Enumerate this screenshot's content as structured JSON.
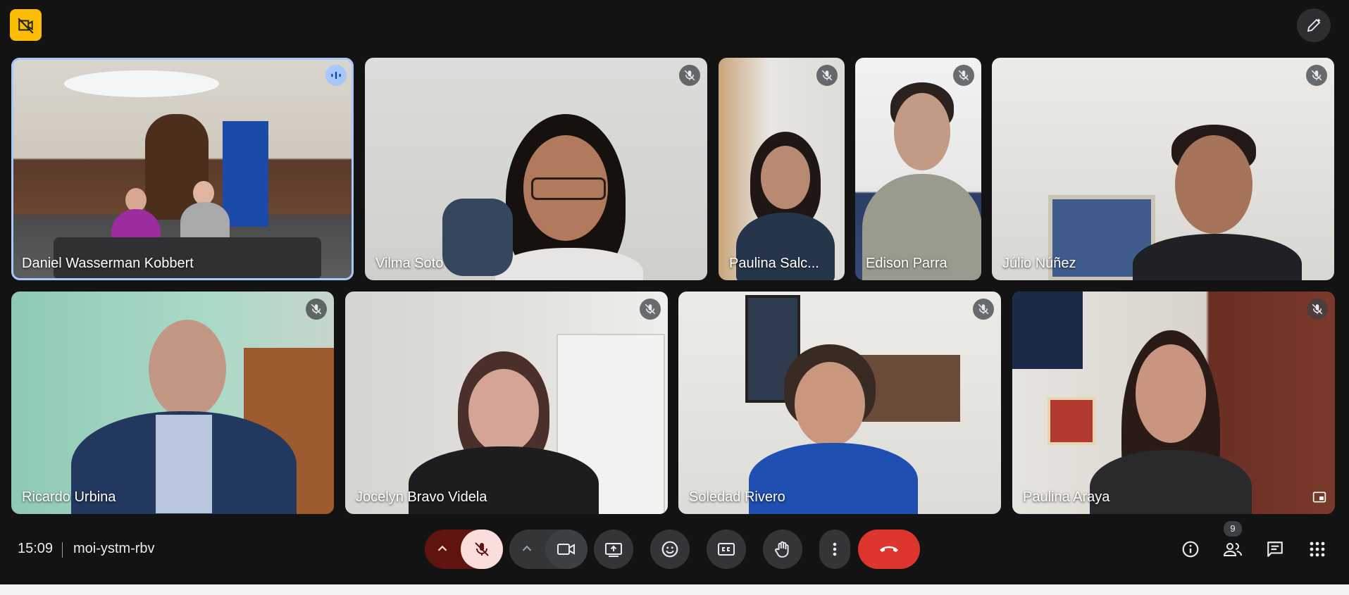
{
  "meeting": {
    "time": "15:09",
    "code": "moi-ystm-rbv",
    "participant_count": "9"
  },
  "participants": [
    {
      "name": "Daniel Wasserman Kobbert",
      "state": "speaking"
    },
    {
      "name": "Vilma Soto",
      "state": "muted"
    },
    {
      "name": "Paulina Salc...",
      "state": "muted"
    },
    {
      "name": "Edison Parra",
      "state": "muted"
    },
    {
      "name": "Júlio Núñez",
      "state": "muted"
    },
    {
      "name": "Ricardo Urbina",
      "state": "muted"
    },
    {
      "name": "Jocelyn Bravo Videla",
      "state": "muted"
    },
    {
      "name": "Soledad Rivero",
      "state": "muted"
    },
    {
      "name": "Paulina Araya",
      "state": "muted"
    }
  ],
  "icons": {
    "top_left": "camera-off-icon",
    "top_right": "edit-pen-icon",
    "mic": "mic-off-icon",
    "camera": "videocam-icon",
    "present": "present-screen-icon",
    "emoji": "emoji-icon",
    "captions": "captions-icon",
    "hand": "raise-hand-icon",
    "more": "more-vert-icon",
    "end": "end-call-icon",
    "info": "info-icon",
    "people": "people-icon",
    "chat": "chat-icon",
    "apps": "apps-icon"
  },
  "colors": {
    "background": "#131314",
    "accent_speaking": "#a8c7fa",
    "end_call": "#dc362e",
    "mic_muted_bg": "#f9dedc",
    "badge_yellow": "#fbbc04"
  }
}
